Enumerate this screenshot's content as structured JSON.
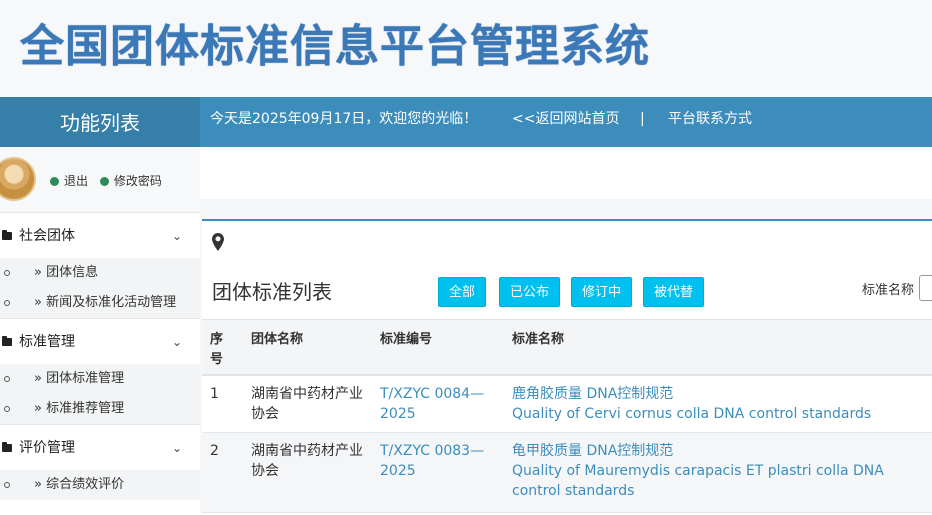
{
  "header": {
    "title": "全国团体标准信息平台管理系统"
  },
  "topbar": {
    "function_list": "功能列表",
    "welcome": "今天是2025年09月17日，欢迎您的光临！",
    "back_link": "<<返回网站首页",
    "divider": "|",
    "contact_link": "平台联系方式"
  },
  "user": {
    "logout": "退出",
    "change_password": "修改密码"
  },
  "sidebar": {
    "groups": [
      {
        "label": "社会团体",
        "items": [
          "» 团体信息",
          "» 新闻及标准化活动管理"
        ]
      },
      {
        "label": "标准管理",
        "items": [
          "» 团体标准管理",
          "» 标准推荐管理"
        ]
      },
      {
        "label": "评价管理",
        "items": [
          "» 综合绩效评价"
        ]
      }
    ]
  },
  "panel": {
    "title": "团体标准列表",
    "filters": [
      "全部",
      "已公布",
      "修订中",
      "被代替"
    ],
    "search_label": "标准名称"
  },
  "table": {
    "headers": {
      "num": "序号",
      "org": "团体名称",
      "code": "标准编号",
      "name": "标准名称"
    },
    "rows": [
      {
        "num": "1",
        "org": "湖南省中药材产业协会",
        "code": "T/XZYC 0084—2025",
        "name_cn": "鹿角胶质量 DNA控制规范",
        "name_en": "Quality of Cervi cornus colla DNA control standards"
      },
      {
        "num": "2",
        "org": "湖南省中药材产业协会",
        "code": "T/XZYC 0083—2025",
        "name_cn": "龟甲胶质量 DNA控制规范",
        "name_en": "Quality of Mauremydis carapacis ET plastri colla DNA control standards"
      }
    ]
  },
  "colors": {
    "primary": "#3c8dbc",
    "primary_dark": "#367fa9",
    "filter_button": "#00c0ef",
    "title": "#3a78b8"
  }
}
